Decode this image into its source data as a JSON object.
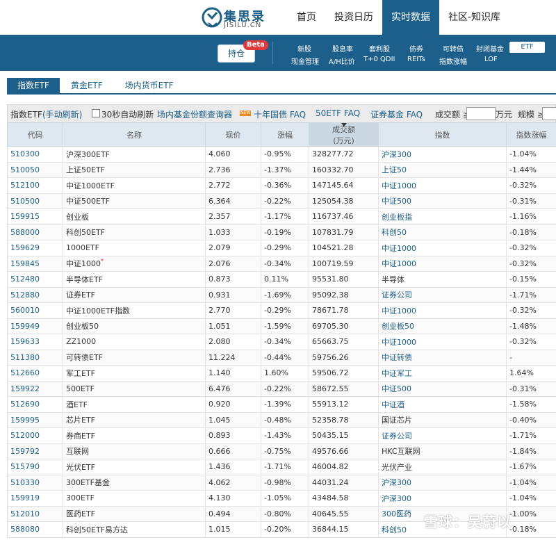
{
  "header": {
    "logo_title": "集思录",
    "logo_sub": "JISILU.CN",
    "nav": [
      "首页",
      "投资日历",
      "实时数据",
      "社区-知识库"
    ],
    "active_nav": "实时数据"
  },
  "subnav": {
    "hold_button": "持仓",
    "beta": "Beta",
    "row1": [
      "新股",
      "股息率",
      "套利股",
      "债券",
      "可转债",
      "封闭基金",
      "ETF"
    ],
    "row2": [
      "现金管理",
      "A/H比价",
      "T+0 QDII",
      "REITs",
      "指数涨幅",
      "LOF"
    ]
  },
  "tabs": [
    "指数ETF",
    "黄金ETF",
    "场内货币ETF"
  ],
  "toolbar": {
    "title": "指数ETF",
    "refresh": "(手动刷新)",
    "auto_refresh": "30秒自动刷新",
    "query": "场内基金份额查询器",
    "new_badge": "NEW",
    "faq1": "十年国债 FAQ",
    "faq2": "50ETF FAQ",
    "faq3": "证券基金 FAQ",
    "volume_label": "成交额 ≥",
    "volume_unit": "万元",
    "scale_label": "规模 ≥"
  },
  "table": {
    "columns": [
      "代码",
      "名称",
      "现价",
      "涨幅",
      "成交额",
      "(万元)",
      "指数",
      "指数涨幅"
    ],
    "rows": [
      {
        "code": "510300",
        "name": "沪深300ETF",
        "price": "4.060",
        "change": "-0.95%",
        "volume": "328277.72",
        "index": "沪深300",
        "index_link": true,
        "index_change": "-1.04%"
      },
      {
        "code": "510050",
        "name": "上证50ETF",
        "price": "2.736",
        "change": "-1.37%",
        "volume": "160332.70",
        "index": "上证50",
        "index_link": true,
        "index_change": "-1.44%"
      },
      {
        "code": "512100",
        "name": "中证1000ETF",
        "price": "2.772",
        "change": "-0.36%",
        "volume": "147145.64",
        "index": "中证1000",
        "index_link": true,
        "index_change": "-0.32%"
      },
      {
        "code": "510500",
        "name": "中证500ETF",
        "price": "6.364",
        "change": "-0.22%",
        "volume": "125054.38",
        "index": "中证500",
        "index_link": true,
        "index_change": "-0.31%"
      },
      {
        "code": "159915",
        "name": "创业板",
        "price": "2.357",
        "change": "-1.17%",
        "volume": "116737.46",
        "index": "创业板指",
        "index_link": true,
        "index_change": "-1.16%"
      },
      {
        "code": "588000",
        "name": "科创50ETF",
        "price": "1.033",
        "change": "-0.19%",
        "volume": "107831.79",
        "index": "科创50",
        "index_link": true,
        "index_change": "-0.18%"
      },
      {
        "code": "159629",
        "name": "1000ETF",
        "price": "2.079",
        "change": "-0.29%",
        "volume": "104521.28",
        "index": "中证1000",
        "index_link": true,
        "index_change": "-0.32%"
      },
      {
        "code": "159845",
        "name": "中证1000",
        "star": "*",
        "price": "2.076",
        "change": "-0.34%",
        "volume": "100719.59",
        "index": "中证1000",
        "index_link": true,
        "index_change": "-0.32%"
      },
      {
        "code": "512480",
        "name": "半导体ETF",
        "price": "0.873",
        "change": "0.11%",
        "volume": "95531.80",
        "index": "半导体",
        "index_link": false,
        "index_change": "-0.15%"
      },
      {
        "code": "512880",
        "name": "证券ETF",
        "price": "0.931",
        "change": "-1.69%",
        "volume": "95092.38",
        "index": "证券公司",
        "index_link": true,
        "index_change": "-1.71%"
      },
      {
        "code": "560010",
        "name": "中证1000ETF指数",
        "price": "2.770",
        "change": "-0.29%",
        "volume": "78671.78",
        "index": "中证1000",
        "index_link": true,
        "index_change": "-0.32%"
      },
      {
        "code": "159949",
        "name": "创业板50",
        "price": "1.051",
        "change": "-1.59%",
        "volume": "69705.30",
        "index": "创业板50",
        "index_link": true,
        "index_change": "-1.48%"
      },
      {
        "code": "159633",
        "name": "ZZ1000",
        "price": "2.080",
        "change": "-0.34%",
        "volume": "65663.75",
        "index": "中证1000",
        "index_link": true,
        "index_change": "-0.32%"
      },
      {
        "code": "511380",
        "name": "可转债ETF",
        "price": "11.224",
        "change": "-0.44%",
        "volume": "59756.26",
        "index": "中证转债",
        "index_link": true,
        "index_change": "-"
      },
      {
        "code": "512660",
        "name": "军工ETF",
        "price": "1.140",
        "change": "1.60%",
        "volume": "59506.72",
        "index": "中证军工",
        "index_link": true,
        "index_change": "1.64%"
      },
      {
        "code": "159922",
        "name": "500ETF",
        "price": "6.476",
        "change": "-0.22%",
        "volume": "58672.55",
        "index": "中证500",
        "index_link": true,
        "index_change": "-0.31%"
      },
      {
        "code": "512690",
        "name": "酒ETF",
        "price": "0.920",
        "change": "-1.39%",
        "volume": "55913.12",
        "index": "中证酒",
        "index_link": true,
        "index_change": "-1.58%"
      },
      {
        "code": "159995",
        "name": "芯片ETF",
        "price": "1.045",
        "change": "-0.48%",
        "volume": "52358.78",
        "index": "国证芯片",
        "index_link": false,
        "index_change": "-0.40%"
      },
      {
        "code": "512000",
        "name": "券商ETF",
        "price": "0.893",
        "change": "-1.43%",
        "volume": "50435.15",
        "index": "证券公司",
        "index_link": true,
        "index_change": "-1.71%"
      },
      {
        "code": "159792",
        "name": "互联网",
        "price": "0.666",
        "change": "-0.75%",
        "volume": "49576.66",
        "index": "HKC互联网",
        "index_link": false,
        "index_change": "-1.84%"
      },
      {
        "code": "515790",
        "name": "光伏ETF",
        "price": "1.436",
        "change": "-1.71%",
        "volume": "46004.82",
        "index": "光伏产业",
        "index_link": false,
        "index_change": "-1.67%"
      },
      {
        "code": "510330",
        "name": "300ETF基金",
        "price": "4.062",
        "change": "-0.98%",
        "volume": "44031.24",
        "index": "沪深300",
        "index_link": true,
        "index_change": "-1.04%"
      },
      {
        "code": "159919",
        "name": "300ETF",
        "price": "4.130",
        "change": "-1.05%",
        "volume": "43484.58",
        "index": "沪深300",
        "index_link": true,
        "index_change": "-1.04%"
      },
      {
        "code": "512010",
        "name": "医药ETF",
        "price": "0.494",
        "change": "-0.80%",
        "volume": "40645.55",
        "index": "300医药",
        "index_link": true,
        "index_change": "-1.00%"
      },
      {
        "code": "588080",
        "name": "科创50ETF易方达",
        "price": "1.015",
        "change": "-0.20%",
        "volume": "36844.15",
        "index": "科创50",
        "index_link": true,
        "index_change": "-0.18%"
      }
    ]
  },
  "watermark": "雪球：吴蔚以",
  "colors": {
    "brand": "#1b5f8a",
    "up": "#e3151f",
    "down": "#1d9a2d"
  }
}
